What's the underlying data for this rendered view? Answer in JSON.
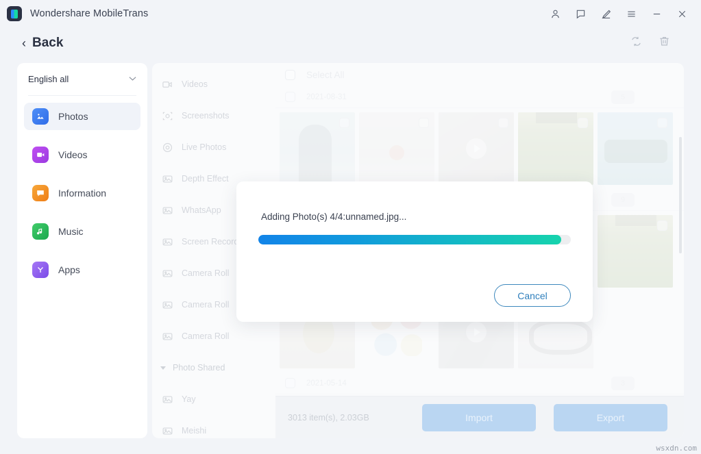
{
  "window": {
    "app_title": "Wondershare MobileTrans",
    "controls": [
      {
        "name": "account-icon",
        "label": "Account"
      },
      {
        "name": "feedback-icon",
        "label": "Feedback"
      },
      {
        "name": "edit-icon",
        "label": "Edit"
      },
      {
        "name": "menu-icon",
        "label": "Menu"
      },
      {
        "name": "minimize-icon",
        "label": "Minimize"
      },
      {
        "name": "close-icon",
        "label": "Close"
      }
    ]
  },
  "header": {
    "back_label": "Back",
    "back_chevron": "‹",
    "tools": [
      {
        "name": "refresh-icon",
        "label": "Refresh"
      },
      {
        "name": "trash-icon",
        "label": "Delete"
      }
    ]
  },
  "sidebar": {
    "language": "English all",
    "caret": "⌄",
    "items": [
      {
        "label": "Photos",
        "icon": "photos-icon",
        "active": true
      },
      {
        "label": "Videos",
        "icon": "videos-icon",
        "active": false
      },
      {
        "label": "Information",
        "icon": "information-icon",
        "active": false
      },
      {
        "label": "Music",
        "icon": "music-icon",
        "active": false
      },
      {
        "label": "Apps",
        "icon": "apps-icon",
        "active": false
      }
    ]
  },
  "categories": [
    {
      "label": "Videos",
      "icon": "video-camera-icon",
      "type": "item"
    },
    {
      "label": "Screenshots",
      "icon": "screenshot-icon",
      "type": "item"
    },
    {
      "label": "Live Photos",
      "icon": "live-photo-icon",
      "type": "item"
    },
    {
      "label": "Depth Effect",
      "icon": "photo-icon",
      "type": "item"
    },
    {
      "label": "WhatsApp",
      "icon": "photo-icon",
      "type": "item"
    },
    {
      "label": "Screen Recorder",
      "icon": "photo-icon",
      "type": "item"
    },
    {
      "label": "Camera Roll",
      "icon": "photo-icon",
      "type": "item"
    },
    {
      "label": "Camera Roll",
      "icon": "photo-icon",
      "type": "item"
    },
    {
      "label": "Camera Roll",
      "icon": "photo-icon",
      "type": "item"
    },
    {
      "label": "Photo Shared",
      "icon": "triangle-down-icon",
      "type": "group"
    },
    {
      "label": "Yay",
      "icon": "photo-icon",
      "type": "item"
    },
    {
      "label": "Meishi",
      "icon": "photo-icon",
      "type": "item"
    }
  ],
  "grid": {
    "select_all_label": "Select All",
    "groups": [
      {
        "date": "2021-08-31",
        "count": "5"
      },
      {
        "date": "",
        "count": "9"
      },
      {
        "date": "2021-05-14",
        "count": "3"
      }
    ]
  },
  "bottom": {
    "stats": "3013 item(s), 2.03GB",
    "import_label": "Import",
    "export_label": "Export"
  },
  "modal": {
    "message": "Adding Photo(s) 4/4:unnamed.jpg...",
    "progress_percent": 97,
    "cancel_label": "Cancel"
  },
  "watermark": "wsxdn.com",
  "colors": {
    "accent_blue": "#1284e8",
    "accent_teal": "#16d3ad",
    "cancel_blue": "#2f7fbc",
    "disabled_button": "#bad6f2",
    "page_bg": "#f2f4f8"
  }
}
